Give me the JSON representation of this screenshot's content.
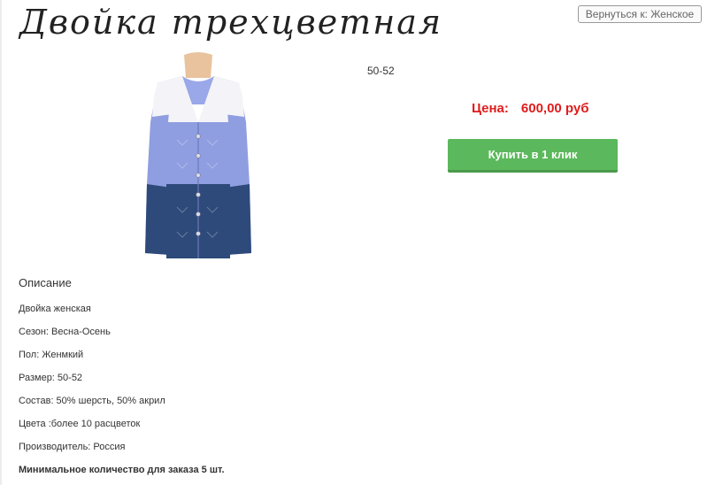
{
  "product": {
    "title": "Двойка трехцветная",
    "size": "50-52",
    "price_label": "Цена:",
    "price_value": "600,00 руб",
    "image_desc": "cardigan-three-color"
  },
  "nav": {
    "back_label": "Вернуться к: Женское"
  },
  "actions": {
    "buy_label": "Купить в 1 клик"
  },
  "description": {
    "heading": "Описание",
    "lines": [
      "Двойка женская",
      "Сезон: Весна-Осень",
      "Пол: Женмкий",
      "Размер: 50-52",
      "Состав: 50% шерсть, 50% акрил",
      "Цвета :более 10 расцветок",
      "Производитель: Россия"
    ],
    "min_order": "Минимальное количество для заказа 5 шт."
  },
  "colors": {
    "price": "#e11b1b",
    "buy_button": "#5cb85c",
    "cardigan_top": "#f4f4f8",
    "cardigan_middle": "#8f9ee0",
    "cardigan_bottom": "#2d4a7a"
  }
}
